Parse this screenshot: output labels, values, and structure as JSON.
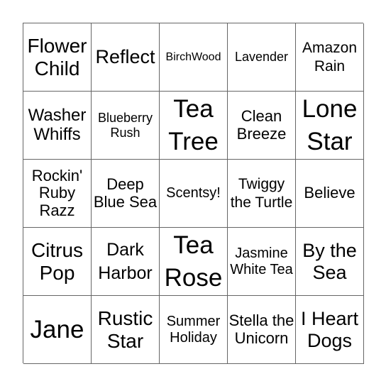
{
  "card": {
    "rows": [
      [
        "Flower Child",
        "Reflect",
        "BirchWood",
        "Lavender",
        "Amazon Rain"
      ],
      [
        "Washer Whiffs",
        "Blueberry Rush",
        "Tea Tree",
        "Clean Breeze",
        "Lone Star"
      ],
      [
        "Rockin' Ruby Razz",
        "Deep Blue Sea",
        "Scentsy!",
        "Twiggy the Turtle",
        "Believe"
      ],
      [
        "Citrus Pop",
        "Dark Harbor",
        "Tea Rose",
        "Jasmine White Tea",
        "By the Sea"
      ],
      [
        "Jane",
        "Rustic Star",
        "Summer Holiday",
        "Stella the Unicorn",
        "I Heart Dogs"
      ]
    ]
  }
}
